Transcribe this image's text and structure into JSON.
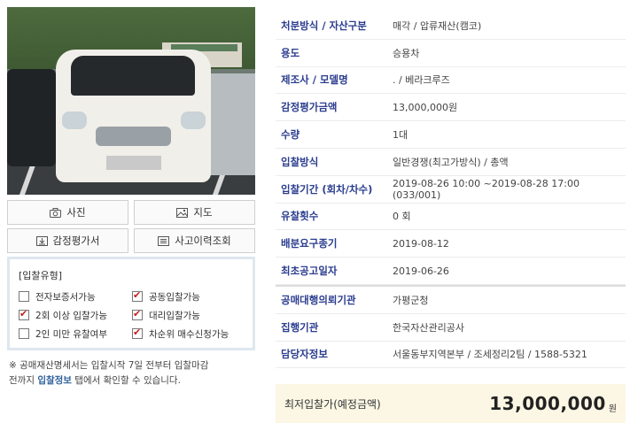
{
  "buttons": {
    "photo": "사진",
    "map": "지도",
    "appraisal": "감정평가서",
    "history": "사고이력조회"
  },
  "bid_types": {
    "title": "[입찰유형]",
    "options": [
      {
        "label": "전자보증서가능",
        "checked": false
      },
      {
        "label": "공동입찰가능",
        "checked": true
      },
      {
        "label": "2회 이상 입찰가능",
        "checked": true
      },
      {
        "label": "대리입찰가능",
        "checked": true
      },
      {
        "label": "2인 미만 유찰여부",
        "checked": false
      },
      {
        "label": "차순위 매수신청가능",
        "checked": true
      }
    ]
  },
  "note": {
    "line1": "※ 공매재산명세서는 입찰시작 7일 전부터 입찰마감",
    "line2_pre": "전까지 ",
    "line2_link": "입찰정보",
    "line2_post": " 탭에서 확인할 수 있습니다."
  },
  "details": [
    {
      "label": "처분방식 / 자산구분",
      "value": "매각 / 압류재산(캠코)"
    },
    {
      "label": "용도",
      "value": "승용차"
    },
    {
      "label": "제조사 / 모델명",
      "value": ". / 베라크루즈"
    },
    {
      "label": "감정평가금액",
      "value": "13,000,000원"
    },
    {
      "label": "수량",
      "value": "1대"
    },
    {
      "label": "입찰방식",
      "value": "일반경쟁(최고가방식) / 총액"
    },
    {
      "label": "입찰기간 (회차/차수)",
      "value": "2019-08-26 10:00 ~2019-08-28 17:00 (033/001)"
    },
    {
      "label": "유찰횟수",
      "value": "0 회"
    },
    {
      "label": "배분요구종기",
      "value": "2019-08-12"
    },
    {
      "label": "최초공고일자",
      "value": "2019-06-26"
    }
  ],
  "agency": [
    {
      "label": "공매대행의뢰기관",
      "value": "가평군청"
    },
    {
      "label": "집행기관",
      "value": "한국자산관리공사"
    },
    {
      "label": "담당자정보",
      "value": "서울동부지역본부 / 조세정리2팀 / 1588-5321"
    }
  ],
  "price": {
    "label": "최저입찰가(예정금액)",
    "value": "13,000,000",
    "unit": "원"
  }
}
